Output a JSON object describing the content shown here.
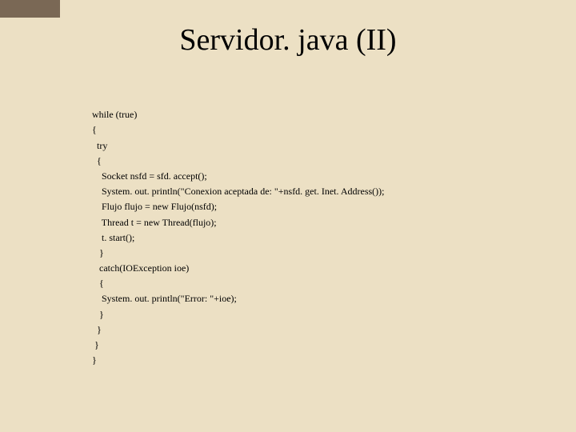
{
  "title": "Servidor. java (II)",
  "code": {
    "l01": "while (true)",
    "l02": "{",
    "l03": "  try",
    "l04": "  {",
    "l05": "    Socket nsfd = sfd. accept();",
    "l06": "    System. out. println(\"Conexion aceptada de: \"+nsfd. get. Inet. Address());",
    "l07": "    Flujo flujo = new Flujo(nsfd);",
    "l08": "    Thread t = new Thread(flujo);",
    "l09": "    t. start();",
    "l10": "   }",
    "l11": "   catch(IOException ioe)",
    "l12": "   {",
    "l13": "    System. out. println(\"Error: \"+ioe);",
    "l14": "   }",
    "l15": "  }",
    "l16": " }",
    "l17": "}"
  }
}
